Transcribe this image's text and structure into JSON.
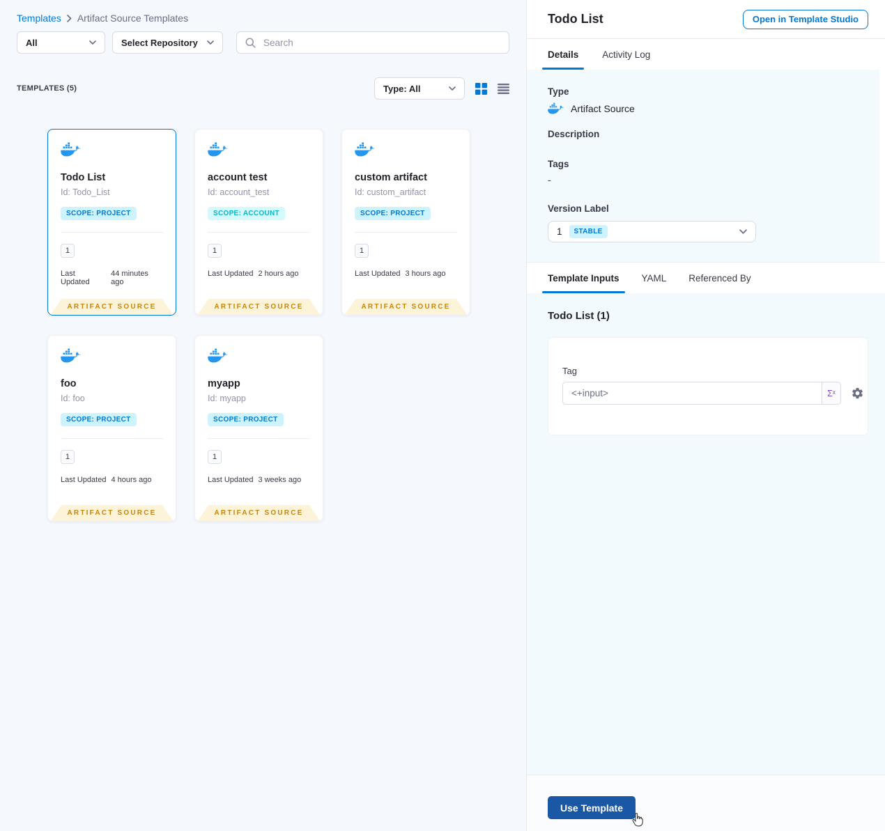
{
  "colors": {
    "accent_blue": "#0278d5",
    "docker_blue": "#2496ed",
    "ribbon_bg": "#fcf3d8",
    "ribbon_text": "#c7860d",
    "scope_project_bg": "#cdf4fe",
    "scope_project_text": "#0278d5",
    "scope_account_bg": "#d4fafb",
    "scope_account_text": "#06b7cb",
    "stable_badge_bg": "#cdf4fe",
    "stable_badge_text": "#0278d5",
    "primary_button_bg": "#1a57a5",
    "panel_section_bg": "#f3fafe",
    "left_bg": "#f5f9fd"
  },
  "breadcrumb": {
    "root": "Templates",
    "current": "Artifact Source Templates"
  },
  "filters": {
    "scope": "All",
    "repository": "Select Repository",
    "search_placeholder": "Search",
    "type": "Type: All"
  },
  "templates_header": {
    "label": "TEMPLATES (5)"
  },
  "cards": [
    {
      "title": "Todo List",
      "id": "Id: Todo_List",
      "scope": "SCOPE: PROJECT",
      "scope_kind": "project",
      "version_count": "1",
      "last_updated_label": "Last Updated",
      "last_updated": "44 minutes ago",
      "ribbon": "ARTIFACT SOURCE",
      "selected": true
    },
    {
      "title": "account test",
      "id": "Id: account_test",
      "scope": "SCOPE: ACCOUNT",
      "scope_kind": "account",
      "version_count": "1",
      "last_updated_label": "Last Updated",
      "last_updated": "2 hours ago",
      "ribbon": "ARTIFACT SOURCE",
      "selected": false
    },
    {
      "title": "custom artifact",
      "id": "Id: custom_artifact",
      "scope": "SCOPE: PROJECT",
      "scope_kind": "project",
      "version_count": "1",
      "last_updated_label": "Last Updated",
      "last_updated": "3 hours ago",
      "ribbon": "ARTIFACT SOURCE",
      "selected": false
    },
    {
      "title": "foo",
      "id": "Id: foo",
      "scope": "SCOPE: PROJECT",
      "scope_kind": "project",
      "version_count": "1",
      "last_updated_label": "Last Updated",
      "last_updated": "4 hours ago",
      "ribbon": "ARTIFACT SOURCE",
      "selected": false
    },
    {
      "title": "myapp",
      "id": "Id: myapp",
      "scope": "SCOPE: PROJECT",
      "scope_kind": "project",
      "version_count": "1",
      "last_updated_label": "Last Updated",
      "last_updated": "3 weeks ago",
      "ribbon": "ARTIFACT SOURCE",
      "selected": false
    }
  ],
  "details_panel": {
    "title": "Todo List",
    "open_button": "Open in Template Studio",
    "tabs": [
      "Details",
      "Activity Log"
    ],
    "fields": {
      "type_label": "Type",
      "type_value": "Artifact Source",
      "description_label": "Description",
      "tags_label": "Tags",
      "tags_value": "-",
      "version_label": "Version Label",
      "version_value": "1",
      "version_badge": "STABLE"
    },
    "sub_tabs": [
      "Template Inputs",
      "YAML",
      "Referenced By"
    ],
    "inputs_heading": "Todo List (1)",
    "tag_label": "Tag",
    "tag_value": "<+input>",
    "sigma": "Σˣ",
    "use_template": "Use Template"
  }
}
